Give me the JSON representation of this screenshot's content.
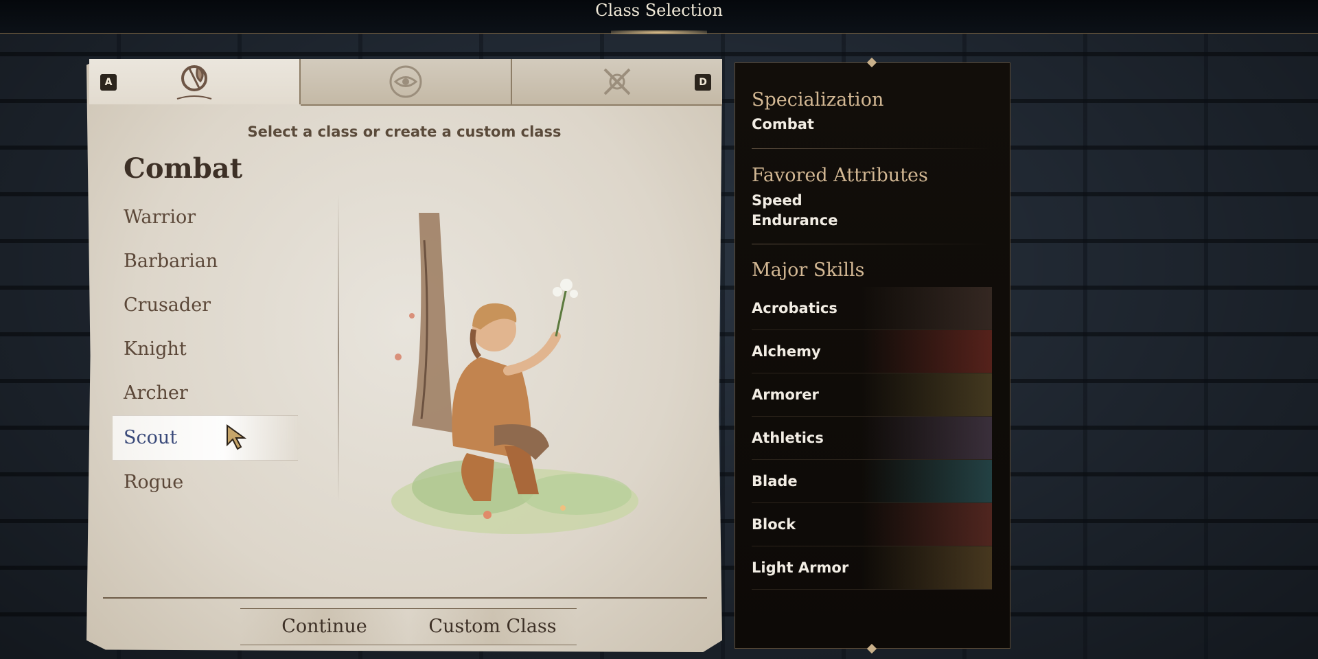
{
  "header": {
    "title": "Class Selection"
  },
  "tabs": [
    {
      "name": "combat",
      "icon": "axe-shield-icon"
    },
    {
      "name": "magic",
      "icon": "eye-sigil-icon"
    },
    {
      "name": "stealth",
      "icon": "crossed-daggers-icon"
    }
  ],
  "keys": {
    "left": "A",
    "right": "D"
  },
  "prompt": "Select a class or create a custom class",
  "category": "Combat",
  "classes": [
    "Warrior",
    "Barbarian",
    "Crusader",
    "Knight",
    "Archer",
    "Scout",
    "Rogue"
  ],
  "selected_class": "Scout",
  "buttons": {
    "continue": "Continue",
    "custom": "Custom Class"
  },
  "details": {
    "specialization_title": "Specialization",
    "specialization": "Combat",
    "attributes_title": "Favored Attributes",
    "attributes": [
      "Speed",
      "Endurance"
    ],
    "skills_title": "Major Skills",
    "skills": [
      "Acrobatics",
      "Alchemy",
      "Armorer",
      "Athletics",
      "Blade",
      "Block",
      "Light Armor"
    ]
  },
  "colors": {
    "accent": "#d3b894",
    "selected": "#3a4a7a"
  }
}
